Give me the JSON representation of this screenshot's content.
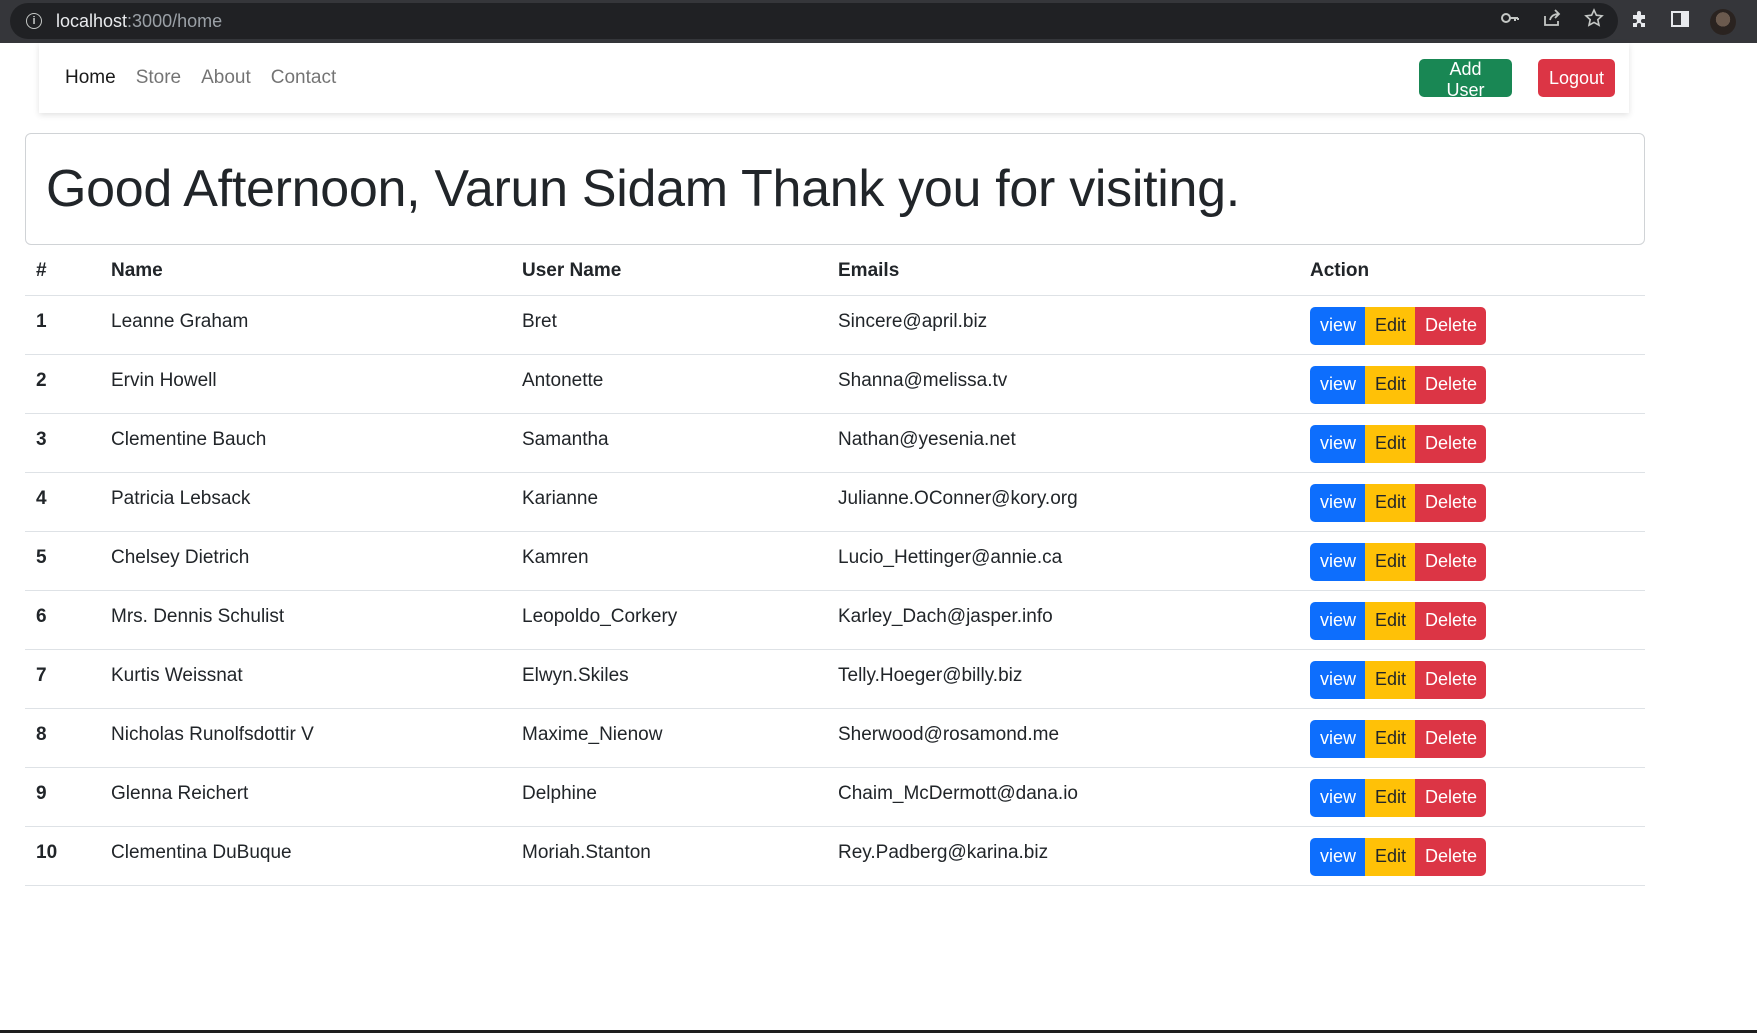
{
  "browser": {
    "url_host": "localhost",
    "url_path": ":3000/home",
    "icons": [
      "info-icon",
      "key-icon",
      "share-icon",
      "star-icon",
      "extensions-icon",
      "sidepanel-icon",
      "avatar"
    ]
  },
  "navbar": {
    "links": [
      {
        "label": "Home",
        "active": true
      },
      {
        "label": "Store",
        "active": false
      },
      {
        "label": "About",
        "active": false
      },
      {
        "label": "Contact",
        "active": false
      }
    ],
    "add_user_label": "Add User",
    "logout_label": "Logout"
  },
  "greeting": "Good Afternoon, Varun Sidam Thank you for visiting.",
  "table": {
    "headers": [
      "#",
      "Name",
      "User Name",
      "Emails",
      "Action"
    ],
    "rows": [
      {
        "idx": "1",
        "name": "Leanne Graham",
        "username": "Bret",
        "email": "Sincere@april.biz"
      },
      {
        "idx": "2",
        "name": "Ervin Howell",
        "username": "Antonette",
        "email": "Shanna@melissa.tv"
      },
      {
        "idx": "3",
        "name": "Clementine Bauch",
        "username": "Samantha",
        "email": "Nathan@yesenia.net"
      },
      {
        "idx": "4",
        "name": "Patricia Lebsack",
        "username": "Karianne",
        "email": "Julianne.OConner@kory.org"
      },
      {
        "idx": "5",
        "name": "Chelsey Dietrich",
        "username": "Kamren",
        "email": "Lucio_Hettinger@annie.ca"
      },
      {
        "idx": "6",
        "name": "Mrs. Dennis Schulist",
        "username": "Leopoldo_Corkery",
        "email": "Karley_Dach@jasper.info"
      },
      {
        "idx": "7",
        "name": "Kurtis Weissnat",
        "username": "Elwyn.Skiles",
        "email": "Telly.Hoeger@billy.biz"
      },
      {
        "idx": "8",
        "name": "Nicholas Runolfsdottir V",
        "username": "Maxime_Nienow",
        "email": "Sherwood@rosamond.me"
      },
      {
        "idx": "9",
        "name": "Glenna Reichert",
        "username": "Delphine",
        "email": "Chaim_McDermott@dana.io"
      },
      {
        "idx": "10",
        "name": "Clementina DuBuque",
        "username": "Moriah.Stanton",
        "email": "Rey.Padberg@karina.biz"
      }
    ],
    "action_labels": {
      "view": "view",
      "edit": "Edit",
      "delete": "Delete"
    }
  },
  "colors": {
    "success": "#198754",
    "danger": "#dc3545",
    "primary": "#0d6efd",
    "warning": "#ffc107"
  }
}
